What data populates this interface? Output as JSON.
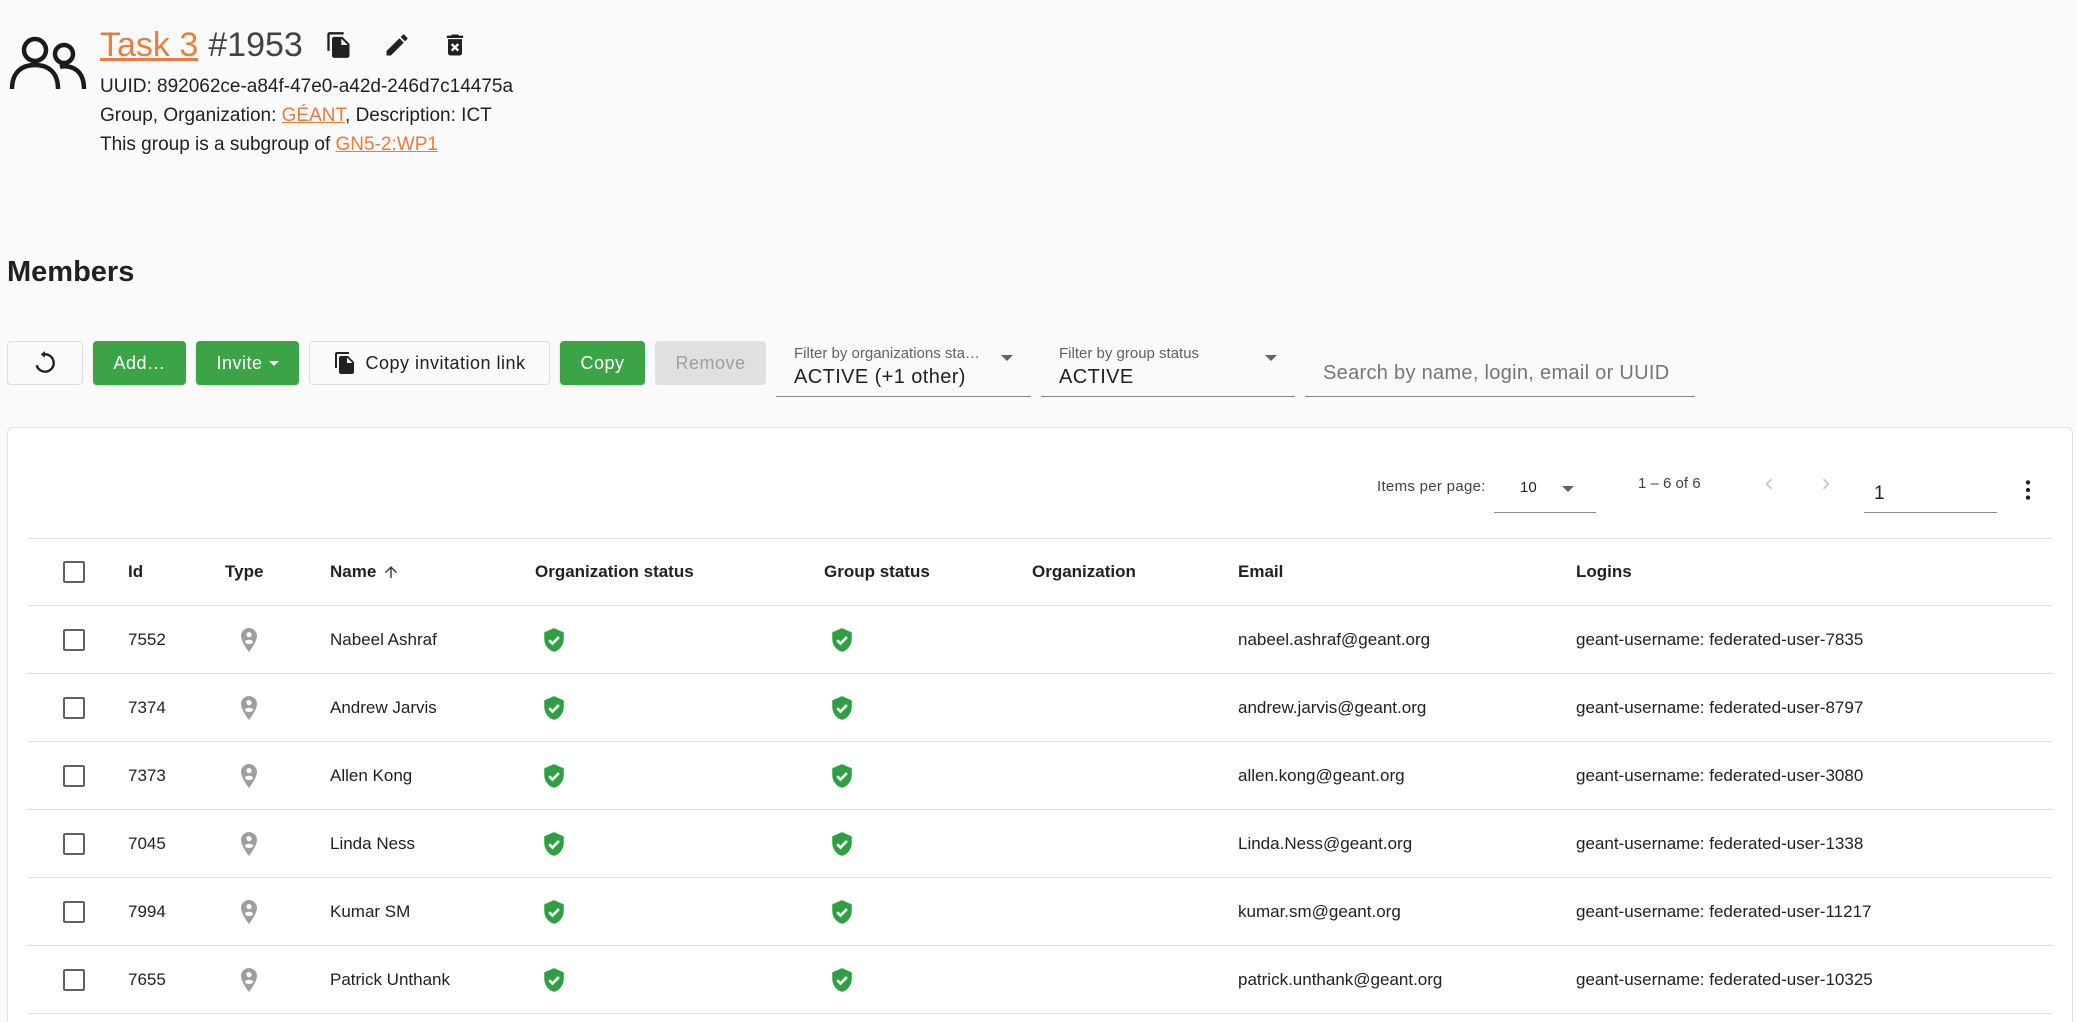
{
  "header": {
    "title": "Task 3",
    "id": "#1953",
    "uuid_line": "UUID: 892062ce-a84f-47e0-a42d-246d7c14475a",
    "group_prefix": "Group, Organization: ",
    "organization": "GÉANT",
    "description_suffix": ", Description: ICT",
    "subgroup_prefix": "This group is a subgroup of ",
    "parent_group": "GN5-2:WP1"
  },
  "members": {
    "heading": "Members"
  },
  "toolbar": {
    "add_label": "Add…",
    "invite_label": "Invite",
    "copy_link_label": "Copy invitation link",
    "copy_label": "Copy",
    "remove_label": "Remove",
    "org_filter_label": "Filter by organizations sta…",
    "org_filter_value": "ACTIVE (+1 other)",
    "group_filter_label": "Filter by group status",
    "group_filter_value": "ACTIVE",
    "search_placeholder": "Search by name, login, email or UUID"
  },
  "paginator": {
    "items_per_page_label": "Items per page:",
    "items_per_page": "10",
    "range": "1 – 6 of 6",
    "page": "1"
  },
  "table": {
    "columns": {
      "id": "Id",
      "type": "Type",
      "name": "Name",
      "org_status": "Organization status",
      "group_status": "Group status",
      "organization": "Organization",
      "email": "Email",
      "logins": "Logins"
    },
    "sorted_column": "name",
    "sort_direction": "ascending",
    "type_icon": "person-pin-icon",
    "status_icon": "verified-shield-icon",
    "status_color": "#2ea043",
    "rows": [
      {
        "id": "7552",
        "name": "Nabeel Ashraf",
        "organization": "",
        "email": "nabeel.ashraf@geant.org",
        "logins": "geant-username: federated-user-7835"
      },
      {
        "id": "7374",
        "name": "Andrew Jarvis",
        "organization": "",
        "email": "andrew.jarvis@geant.org",
        "logins": "geant-username: federated-user-8797"
      },
      {
        "id": "7373",
        "name": "Allen Kong",
        "organization": "",
        "email": "allen.kong@geant.org",
        "logins": "geant-username: federated-user-3080"
      },
      {
        "id": "7045",
        "name": "Linda Ness",
        "organization": "",
        "email": "Linda.Ness@geant.org",
        "logins": "geant-username: federated-user-1338"
      },
      {
        "id": "7994",
        "name": "Kumar SM",
        "organization": "",
        "email": "kumar.sm@geant.org",
        "logins": "geant-username: federated-user-11217"
      },
      {
        "id": "7655",
        "name": "Patrick Unthank",
        "organization": "",
        "email": "patrick.unthank@geant.org",
        "logins": "geant-username: federated-user-10325"
      }
    ]
  },
  "colors": {
    "accent_link": "#e87d3e",
    "primary_button": "#3ca447",
    "status_ok": "#2ea043"
  }
}
